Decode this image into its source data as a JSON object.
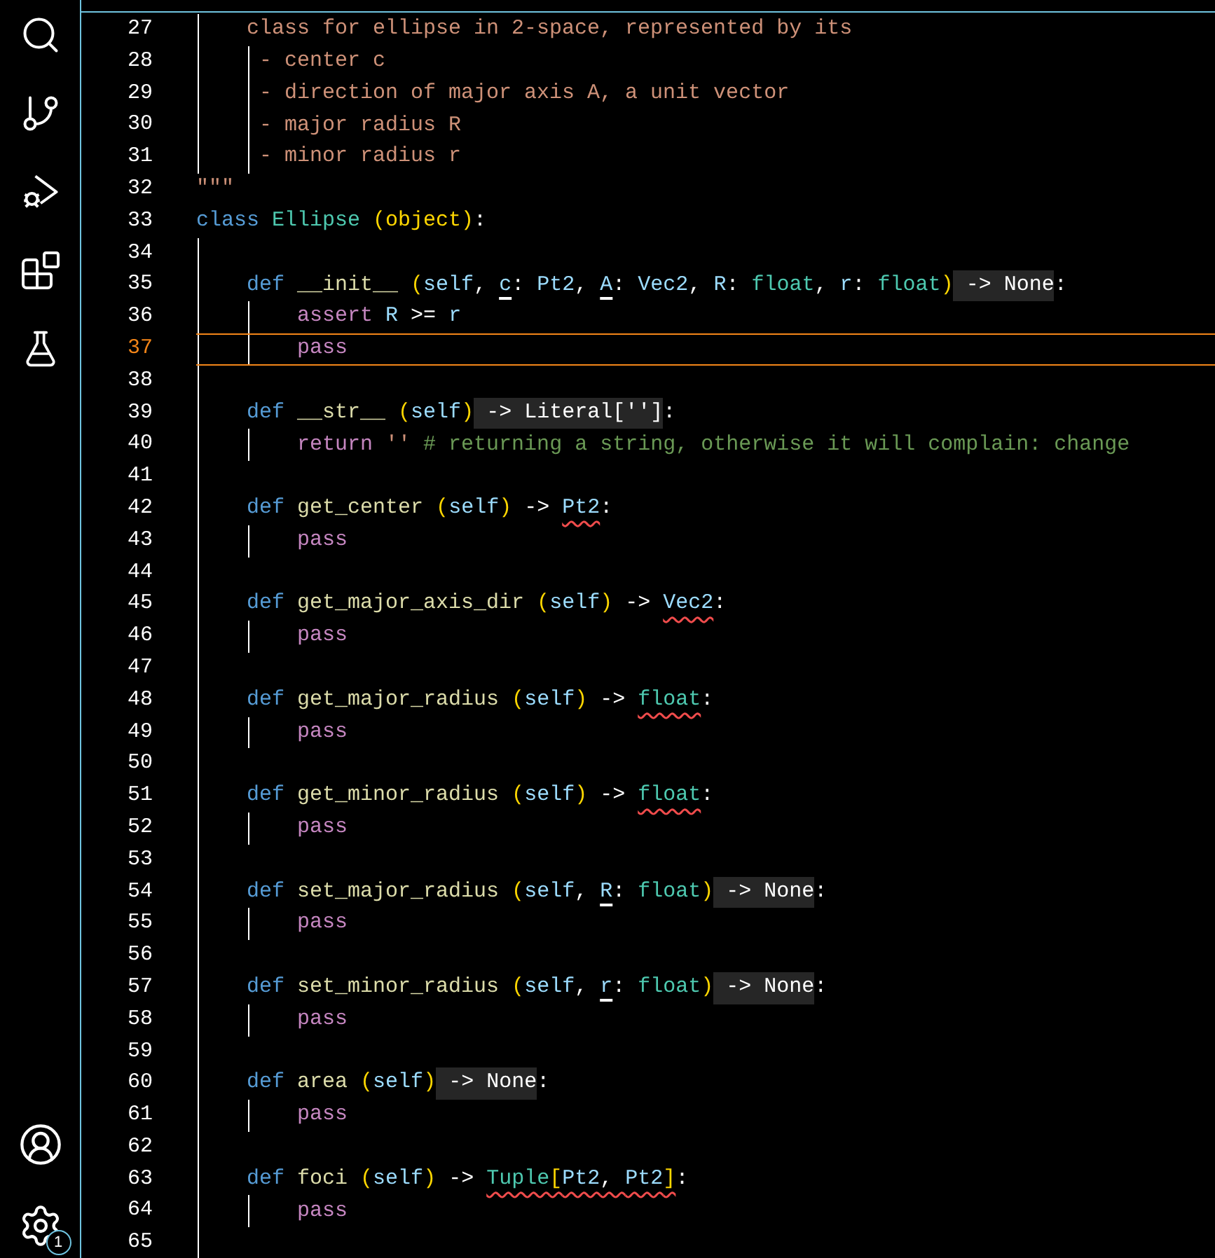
{
  "activity_bar": {
    "items": [
      {
        "kind": "search"
      },
      {
        "kind": "source_control"
      },
      {
        "kind": "run_debug"
      },
      {
        "kind": "extensions"
      },
      {
        "kind": "testing"
      }
    ],
    "bottom": [
      {
        "kind": "account"
      },
      {
        "kind": "settings",
        "badge": "1"
      }
    ]
  },
  "editor": {
    "lines": [
      {
        "number": "27",
        "current": false,
        "tokens": [
          {
            "kind": "string",
            "text": "    class for ellipse in 2-space, represented by its"
          }
        ]
      },
      {
        "number": "28",
        "current": false,
        "tokens": [
          {
            "kind": "string",
            "text": "     - center c"
          }
        ]
      },
      {
        "number": "29",
        "current": false,
        "tokens": [
          {
            "kind": "string",
            "text": "     - direction of major axis A, a unit vector"
          }
        ]
      },
      {
        "number": "30",
        "current": false,
        "tokens": [
          {
            "kind": "string",
            "text": "     - major radius R"
          }
        ]
      },
      {
        "number": "31",
        "current": false,
        "tokens": [
          {
            "kind": "string",
            "text": "     - minor radius r"
          }
        ]
      },
      {
        "number": "32",
        "current": false,
        "tokens": [
          {
            "kind": "string",
            "text": "\"\"\""
          }
        ]
      },
      {
        "number": "33",
        "current": false,
        "tokens": [
          {
            "kind": "keyword",
            "text": "class"
          },
          {
            "kind": "type",
            "text": " Ellipse"
          },
          {
            "kind": "bracket",
            "text": " (object)"
          },
          {
            "kind": "plain",
            "text": ":"
          }
        ]
      },
      {
        "number": "34",
        "current": false
      },
      {
        "number": "35",
        "current": false,
        "tokens": [
          {
            "kind": "keyword",
            "text": "    def"
          },
          {
            "kind": "function",
            "text": " __init__"
          },
          {
            "kind": "bracket",
            "text": " ("
          },
          {
            "kind": "param",
            "text": "self"
          },
          {
            "kind": "plain",
            "text": ", "
          },
          {
            "kind": "param",
            "text": "c",
            "underline": true
          },
          {
            "kind": "plain",
            "text": ": "
          },
          {
            "kind": "param",
            "text": "Pt2"
          },
          {
            "kind": "plain",
            "text": ", "
          },
          {
            "kind": "param",
            "text": "A",
            "underline": true
          },
          {
            "kind": "plain",
            "text": ": "
          },
          {
            "kind": "param",
            "text": "Vec2"
          },
          {
            "kind": "plain",
            "text": ", "
          },
          {
            "kind": "param",
            "text": "R"
          },
          {
            "kind": "plain",
            "text": ": "
          },
          {
            "kind": "type",
            "text": "float"
          },
          {
            "kind": "plain",
            "text": ", "
          },
          {
            "kind": "param",
            "text": "r"
          },
          {
            "kind": "plain",
            "text": ": "
          },
          {
            "kind": "type",
            "text": "float"
          },
          {
            "kind": "bracket",
            "text": ")"
          },
          {
            "kind": "hint",
            "text": " -> None"
          },
          {
            "kind": "plain",
            "text": ":"
          }
        ]
      },
      {
        "number": "36",
        "current": false,
        "tokens": [
          {
            "kind": "control",
            "text": "        assert"
          },
          {
            "kind": "param",
            "text": " R"
          },
          {
            "kind": "plain",
            "text": " >= "
          },
          {
            "kind": "param",
            "text": "r"
          }
        ]
      },
      {
        "number": "37",
        "current": true,
        "tokens": [
          {
            "kind": "control",
            "text": "        pass"
          }
        ]
      },
      {
        "number": "38",
        "current": false
      },
      {
        "number": "39",
        "current": false,
        "tokens": [
          {
            "kind": "keyword",
            "text": "    def"
          },
          {
            "kind": "function",
            "text": " __str__"
          },
          {
            "kind": "bracket",
            "text": " ("
          },
          {
            "kind": "param",
            "text": "self"
          },
          {
            "kind": "bracket",
            "text": ")"
          },
          {
            "kind": "hint",
            "text": " -> Literal['']"
          },
          {
            "kind": "plain",
            "text": ":"
          }
        ]
      },
      {
        "number": "40",
        "current": false,
        "tokens": [
          {
            "kind": "control",
            "text": "        return"
          },
          {
            "kind": "string",
            "text": " ''"
          },
          {
            "kind": "comment",
            "text": " # returning a string, otherwise it will complain: change"
          }
        ]
      },
      {
        "number": "41",
        "current": false
      },
      {
        "number": "42",
        "current": false,
        "tokens": [
          {
            "kind": "keyword",
            "text": "    def"
          },
          {
            "kind": "function",
            "text": " get_center"
          },
          {
            "kind": "bracket",
            "text": " ("
          },
          {
            "kind": "param",
            "text": "self"
          },
          {
            "kind": "bracket",
            "text": ")"
          },
          {
            "kind": "plain",
            "text": " -> "
          },
          {
            "kind": "param",
            "text": "Pt2",
            "error": true
          },
          {
            "kind": "plain",
            "text": ":"
          }
        ]
      },
      {
        "number": "43",
        "current": false,
        "tokens": [
          {
            "kind": "control",
            "text": "        pass"
          }
        ]
      },
      {
        "number": "44",
        "current": false
      },
      {
        "number": "45",
        "current": false,
        "tokens": [
          {
            "kind": "keyword",
            "text": "    def"
          },
          {
            "kind": "function",
            "text": " get_major_axis_dir"
          },
          {
            "kind": "bracket",
            "text": " ("
          },
          {
            "kind": "param",
            "text": "self"
          },
          {
            "kind": "bracket",
            "text": ")"
          },
          {
            "kind": "plain",
            "text": " -> "
          },
          {
            "kind": "param",
            "text": "Vec2",
            "error": true
          },
          {
            "kind": "plain",
            "text": ":"
          }
        ]
      },
      {
        "number": "46",
        "current": false,
        "tokens": [
          {
            "kind": "control",
            "text": "        pass"
          }
        ]
      },
      {
        "number": "47",
        "current": false
      },
      {
        "number": "48",
        "current": false,
        "tokens": [
          {
            "kind": "keyword",
            "text": "    def"
          },
          {
            "kind": "function",
            "text": " get_major_radius"
          },
          {
            "kind": "bracket",
            "text": " ("
          },
          {
            "kind": "param",
            "text": "self"
          },
          {
            "kind": "bracket",
            "text": ")"
          },
          {
            "kind": "plain",
            "text": " -> "
          },
          {
            "kind": "type",
            "text": "float",
            "error": true
          },
          {
            "kind": "plain",
            "text": ":"
          }
        ]
      },
      {
        "number": "49",
        "current": false,
        "tokens": [
          {
            "kind": "control",
            "text": "        pass"
          }
        ]
      },
      {
        "number": "50",
        "current": false
      },
      {
        "number": "51",
        "current": false,
        "tokens": [
          {
            "kind": "keyword",
            "text": "    def"
          },
          {
            "kind": "function",
            "text": " get_minor_radius"
          },
          {
            "kind": "bracket",
            "text": " ("
          },
          {
            "kind": "param",
            "text": "self"
          },
          {
            "kind": "bracket",
            "text": ")"
          },
          {
            "kind": "plain",
            "text": " -> "
          },
          {
            "kind": "type",
            "text": "float",
            "error": true
          },
          {
            "kind": "plain",
            "text": ":"
          }
        ]
      },
      {
        "number": "52",
        "current": false,
        "tokens": [
          {
            "kind": "control",
            "text": "        pass"
          }
        ]
      },
      {
        "number": "53",
        "current": false
      },
      {
        "number": "54",
        "current": false,
        "tokens": [
          {
            "kind": "keyword",
            "text": "    def"
          },
          {
            "kind": "function",
            "text": " set_major_radius"
          },
          {
            "kind": "bracket",
            "text": " ("
          },
          {
            "kind": "param",
            "text": "self"
          },
          {
            "kind": "plain",
            "text": ", "
          },
          {
            "kind": "param",
            "text": "R",
            "underline": true
          },
          {
            "kind": "plain",
            "text": ": "
          },
          {
            "kind": "type",
            "text": "float"
          },
          {
            "kind": "bracket",
            "text": ")"
          },
          {
            "kind": "hint",
            "text": " -> None"
          },
          {
            "kind": "plain",
            "text": ":"
          }
        ]
      },
      {
        "number": "55",
        "current": false,
        "tokens": [
          {
            "kind": "control",
            "text": "        pass"
          }
        ]
      },
      {
        "number": "56",
        "current": false
      },
      {
        "number": "57",
        "current": false,
        "tokens": [
          {
            "kind": "keyword",
            "text": "    def"
          },
          {
            "kind": "function",
            "text": " set_minor_radius"
          },
          {
            "kind": "bracket",
            "text": " ("
          },
          {
            "kind": "param",
            "text": "self"
          },
          {
            "kind": "plain",
            "text": ", "
          },
          {
            "kind": "param",
            "text": "r",
            "underline": true
          },
          {
            "kind": "plain",
            "text": ": "
          },
          {
            "kind": "type",
            "text": "float"
          },
          {
            "kind": "bracket",
            "text": ")"
          },
          {
            "kind": "hint",
            "text": " -> None"
          },
          {
            "kind": "plain",
            "text": ":"
          }
        ]
      },
      {
        "number": "58",
        "current": false,
        "tokens": [
          {
            "kind": "control",
            "text": "        pass"
          }
        ]
      },
      {
        "number": "59",
        "current": false
      },
      {
        "number": "60",
        "current": false,
        "tokens": [
          {
            "kind": "keyword",
            "text": "    def"
          },
          {
            "kind": "function",
            "text": " area"
          },
          {
            "kind": "bracket",
            "text": " ("
          },
          {
            "kind": "param",
            "text": "self"
          },
          {
            "kind": "bracket",
            "text": ")"
          },
          {
            "kind": "hint",
            "text": " -> None"
          },
          {
            "kind": "plain",
            "text": ":"
          }
        ]
      },
      {
        "number": "61",
        "current": false,
        "tokens": [
          {
            "kind": "control",
            "text": "        pass"
          }
        ]
      },
      {
        "number": "62",
        "current": false
      },
      {
        "number": "63",
        "current": false,
        "tokens": [
          {
            "kind": "keyword",
            "text": "    def"
          },
          {
            "kind": "function",
            "text": " foci"
          },
          {
            "kind": "bracket",
            "text": " ("
          },
          {
            "kind": "param",
            "text": "self"
          },
          {
            "kind": "bracket",
            "text": ")"
          },
          {
            "kind": "plain",
            "text": " -> "
          },
          {
            "kind": "type",
            "text": "Tuple",
            "error": true
          },
          {
            "kind": "bracket",
            "text": "[",
            "error": true
          },
          {
            "kind": "param",
            "text": "Pt2",
            "error": true
          },
          {
            "kind": "plain",
            "text": ", ",
            "error": true
          },
          {
            "kind": "param",
            "text": "Pt2",
            "error": true
          },
          {
            "kind": "bracket",
            "text": "]",
            "error": true
          },
          {
            "kind": "plain",
            "text": ":"
          }
        ]
      },
      {
        "number": "64",
        "current": false,
        "tokens": [
          {
            "kind": "control",
            "text": "        pass"
          }
        ]
      },
      {
        "number": "65",
        "current": false
      }
    ]
  }
}
